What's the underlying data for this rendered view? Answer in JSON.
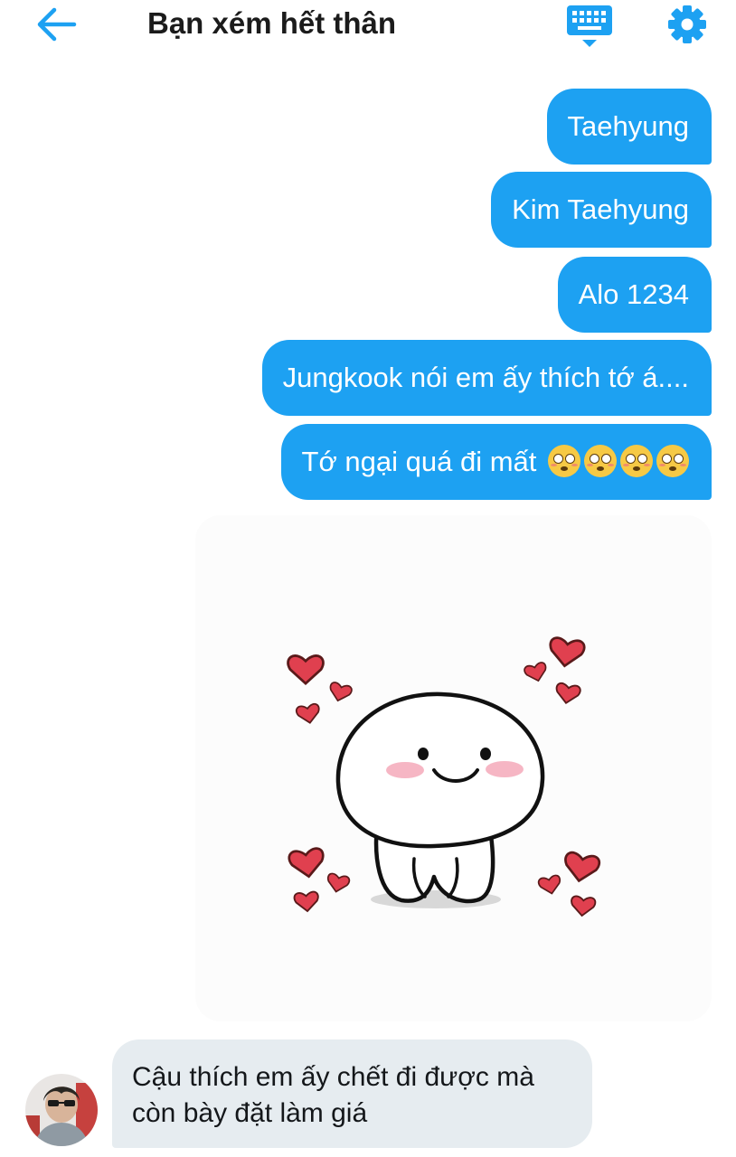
{
  "header": {
    "title": "Bạn xém hết thân",
    "back_icon": "arrow-left-icon",
    "keyboard_icon": "keyboard-icon",
    "settings_icon": "gear-icon",
    "accent_color": "#1da1f2"
  },
  "messages_out": [
    {
      "text": "Taehyung"
    },
    {
      "text": "Kim Taehyung"
    },
    {
      "text": "Alo 1234"
    },
    {
      "text": "Jungkook nói em ấy thích tớ á...."
    },
    {
      "text": "Tớ ngại quá đi mất",
      "emoji_icon": "flushed-face-emoji",
      "emoji_count": 4
    }
  ],
  "sticker": {
    "icon": "blushing-character-with-hearts-sticker"
  },
  "message_in": {
    "line1": "Cậu thích em ấy chết đi được mà",
    "line2": "còn bày đặt làm giá",
    "avatar_icon": "user-avatar"
  },
  "colors": {
    "outgoing_bubble": "#1da1f2",
    "incoming_bubble": "#e6ecf0",
    "heart": "#e0404f"
  }
}
